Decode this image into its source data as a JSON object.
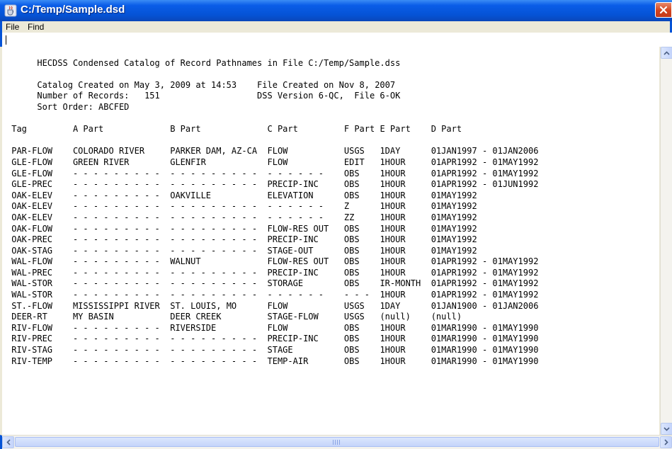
{
  "window": {
    "title": "C:/Temp/Sample.dsd"
  },
  "menu": {
    "file": "File",
    "find": "Find"
  },
  "catalog": {
    "heading": "HECDSS Condensed Catalog of Record Pathnames in File C:/Temp/Sample.dss",
    "created_label": "Catalog Created on May 3, 2009 at 14:53",
    "file_created": "File Created on Nov 8, 2007",
    "num_records_label": "Number of Records:",
    "num_records": "151",
    "dss_version": "DSS Version 6-QC,  File 6-OK",
    "sort_order": "Sort Order: ABCFED",
    "columns": [
      "Tag",
      "A Part",
      "B Part",
      "C Part",
      "F Part",
      "E Part",
      "D Part"
    ],
    "rows": [
      [
        "PAR-FLOW",
        "COLORADO RIVER",
        "PARKER DAM, AZ-CA",
        "FLOW",
        "USGS",
        "1DAY",
        "01JAN1997 - 01JAN2006"
      ],
      [
        "GLE-FLOW",
        "GREEN RIVER",
        "GLENFIR",
        "FLOW",
        "EDIT",
        "1HOUR",
        "01APR1992 - 01MAY1992"
      ],
      [
        "GLE-FLOW",
        "- - - - - - - - -",
        "- - - - - - - - -",
        "- - - - - -",
        "OBS",
        "1HOUR",
        "01APR1992 - 01MAY1992"
      ],
      [
        "GLE-PREC",
        "- - - - - - - - -",
        "- - - - - - - - -",
        "PRECIP-INC",
        "OBS",
        "1HOUR",
        "01APR1992 - 01JUN1992"
      ],
      [
        "OAK-ELEV",
        "- - - - - - - - -",
        "OAKVILLE",
        "ELEVATION",
        "OBS",
        "1HOUR",
        "01MAY1992"
      ],
      [
        "OAK-ELEV",
        "- - - - - - - - -",
        "- - - - - - - - -",
        "- - - - - -",
        "Z",
        "1HOUR",
        "01MAY1992"
      ],
      [
        "OAK-ELEV",
        "- - - - - - - - -",
        "- - - - - - - - -",
        "- - - - - -",
        "ZZ",
        "1HOUR",
        "01MAY1992"
      ],
      [
        "OAK-FLOW",
        "- - - - - - - - -",
        "- - - - - - - - -",
        "FLOW-RES OUT",
        "OBS",
        "1HOUR",
        "01MAY1992"
      ],
      [
        "OAK-PREC",
        "- - - - - - - - -",
        "- - - - - - - - -",
        "PRECIP-INC",
        "OBS",
        "1HOUR",
        "01MAY1992"
      ],
      [
        "OAK-STAG",
        "- - - - - - - - -",
        "- - - - - - - - -",
        "STAGE-OUT",
        "OBS",
        "1HOUR",
        "01MAY1992"
      ],
      [
        "WAL-FLOW",
        "- - - - - - - - -",
        "WALNUT",
        "FLOW-RES OUT",
        "OBS",
        "1HOUR",
        "01APR1992 - 01MAY1992"
      ],
      [
        "WAL-PREC",
        "- - - - - - - - -",
        "- - - - - - - - -",
        "PRECIP-INC",
        "OBS",
        "1HOUR",
        "01APR1992 - 01MAY1992"
      ],
      [
        "WAL-STOR",
        "- - - - - - - - -",
        "- - - - - - - - -",
        "STORAGE",
        "OBS",
        "IR-MONTH",
        "01APR1992 - 01MAY1992"
      ],
      [
        "WAL-STOR",
        "- - - - - - - - -",
        "- - - - - - - - -",
        "- - - - - -",
        "- - -",
        "1HOUR",
        "01APR1992 - 01MAY1992"
      ],
      [
        "ST.-FLOW",
        "MISSISSIPPI RIVER",
        "ST. LOUIS, MO",
        "FLOW",
        "USGS",
        "1DAY",
        "01JAN1900 - 01JAN2006"
      ],
      [
        "DEER-RT",
        "MY BASIN",
        "DEER CREEK",
        "STAGE-FLOW",
        "USGS",
        "(null)",
        "(null)"
      ],
      [
        "RIV-FLOW",
        "- - - - - - - - -",
        "RIVERSIDE",
        "FLOW",
        "OBS",
        "1HOUR",
        "01MAR1990 - 01MAY1990"
      ],
      [
        "RIV-PREC",
        "- - - - - - - - -",
        "- - - - - - - - -",
        "PRECIP-INC",
        "OBS",
        "1HOUR",
        "01MAR1990 - 01MAY1990"
      ],
      [
        "RIV-STAG",
        "- - - - - - - - -",
        "- - - - - - - - -",
        "STAGE",
        "OBS",
        "1HOUR",
        "01MAR1990 - 01MAY1990"
      ],
      [
        "RIV-TEMP",
        "- - - - - - - - -",
        "- - - - - - - - -",
        "TEMP-AIR",
        "OBS",
        "1HOUR",
        "01MAR1990 - 01MAY1990"
      ]
    ]
  },
  "icons": {
    "app": "java-cup-icon",
    "close": "close-icon",
    "scroll_up": "arrow-up-icon",
    "scroll_down": "arrow-down-icon",
    "scroll_left": "arrow-left-icon",
    "scroll_right": "arrow-right-icon"
  },
  "colors": {
    "titlebar": "#0553d6",
    "close_button": "#d3431d",
    "scrollbar": "#c3d3fb",
    "text_area": "#ffffff"
  }
}
